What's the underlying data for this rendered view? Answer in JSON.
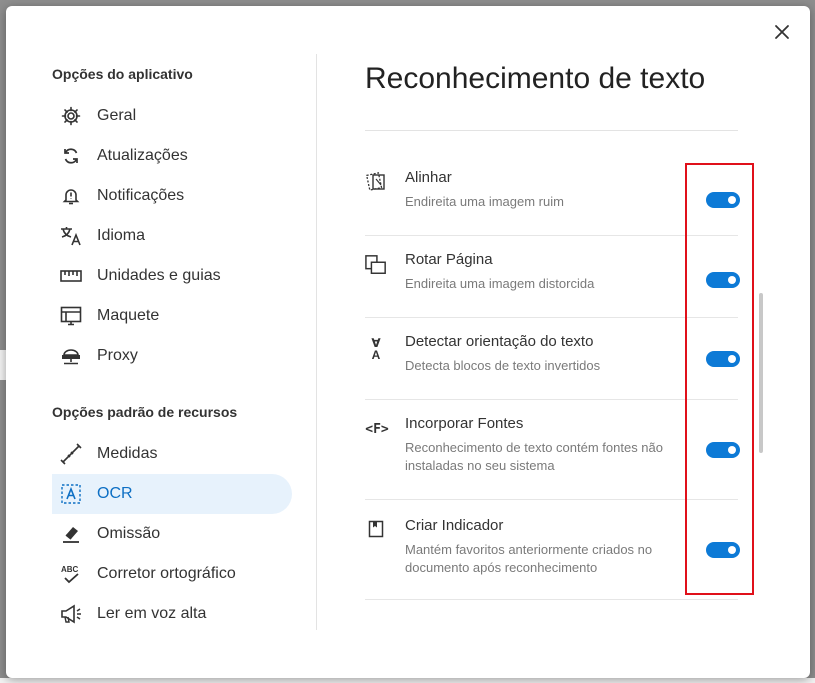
{
  "dialog": {
    "close_icon": "close-icon"
  },
  "sidebar": {
    "app_section_title": "Opções do aplicativo",
    "app_items": [
      {
        "label": "Geral",
        "icon": "gear-icon"
      },
      {
        "label": "Atualizações",
        "icon": "refresh-icon"
      },
      {
        "label": "Notificações",
        "icon": "bell-alert-icon"
      },
      {
        "label": "Idioma",
        "icon": "translate-icon"
      },
      {
        "label": "Unidades e guias",
        "icon": "ruler-icon"
      },
      {
        "label": "Maquete",
        "icon": "layout-icon"
      },
      {
        "label": "Proxy",
        "icon": "network-icon"
      }
    ],
    "resource_section_title": "Opções padrão de recursos",
    "resource_items": [
      {
        "label": "Medidas",
        "icon": "measure-icon"
      },
      {
        "label": "OCR",
        "icon": "ocr-icon",
        "active": true
      },
      {
        "label": "Omissão",
        "icon": "eraser-icon"
      },
      {
        "label": "Corretor ortográfico",
        "icon": "spellcheck-icon"
      },
      {
        "label": "Ler em voz alta",
        "icon": "megaphone-icon"
      }
    ]
  },
  "content": {
    "title": "Reconhecimento de texto",
    "options": [
      {
        "title": "Alinhar",
        "desc1": "Endireita uma imagem ruim",
        "desc2": "",
        "icon": "deskew-icon",
        "enabled": true
      },
      {
        "title": "Rotar Página",
        "desc1": "Endireita uma imagem distorcida",
        "desc2": "",
        "icon": "rotate-page-icon",
        "enabled": true
      },
      {
        "title": "Detectar orientação do texto",
        "desc1": "Detecta blocos de texto invertidos",
        "desc2": "",
        "icon": "text-orientation-icon",
        "enabled": true
      },
      {
        "title": "Incorporar Fontes",
        "desc1": "Reconhecimento de texto contém fontes não",
        "desc2": "instaladas no seu sistema",
        "icon": "embed-fonts-icon",
        "enabled": true
      },
      {
        "title": "Criar Indicador",
        "desc1": "Mantém favoritos anteriormente criados no",
        "desc2": "documento após reconhecimento",
        "icon": "bookmark-icon",
        "enabled": true
      }
    ],
    "embed_fonts_glyph": "<F>",
    "orientation_glyph_top": "∀",
    "orientation_glyph_bottom": "A"
  },
  "colors": {
    "accent": "#0d7ad6",
    "active_bg": "#e7f2fc",
    "highlight": "#e0101a"
  }
}
